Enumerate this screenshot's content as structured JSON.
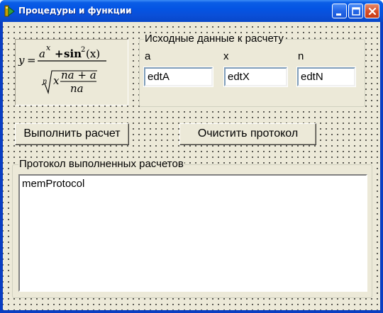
{
  "window": {
    "title": "Процедуры и функции",
    "controls": {
      "minimize": "minimize-icon",
      "maximize": "maximize-icon",
      "close": "close-icon"
    },
    "colors": {
      "titlebar": "#0454e3",
      "client": "#ece9d8",
      "close": "#d8502a"
    }
  },
  "formula": {
    "image": "formula-image",
    "lhs": "y",
    "equals": "=",
    "numerator_base": "a",
    "numerator_exp": "x",
    "plus": "+",
    "sin": "sin",
    "sin_exp": "2",
    "sin_arg": "(x)",
    "root_index": "n",
    "radicand_x": "x",
    "inner_num": "na + a",
    "inner_den": "na"
  },
  "input_group": {
    "title": "Исходные данные к расчету",
    "fields": [
      {
        "label": "a",
        "value": "edtA"
      },
      {
        "label": "x",
        "value": "edtX"
      },
      {
        "label": "n",
        "value": "edtN"
      }
    ]
  },
  "buttons": {
    "calculate": "Выполнить расчет",
    "clear": "Очистить протокол"
  },
  "protocol_group": {
    "title": "Протокол выполненных расчетов",
    "memo_text": "memProtocol"
  }
}
